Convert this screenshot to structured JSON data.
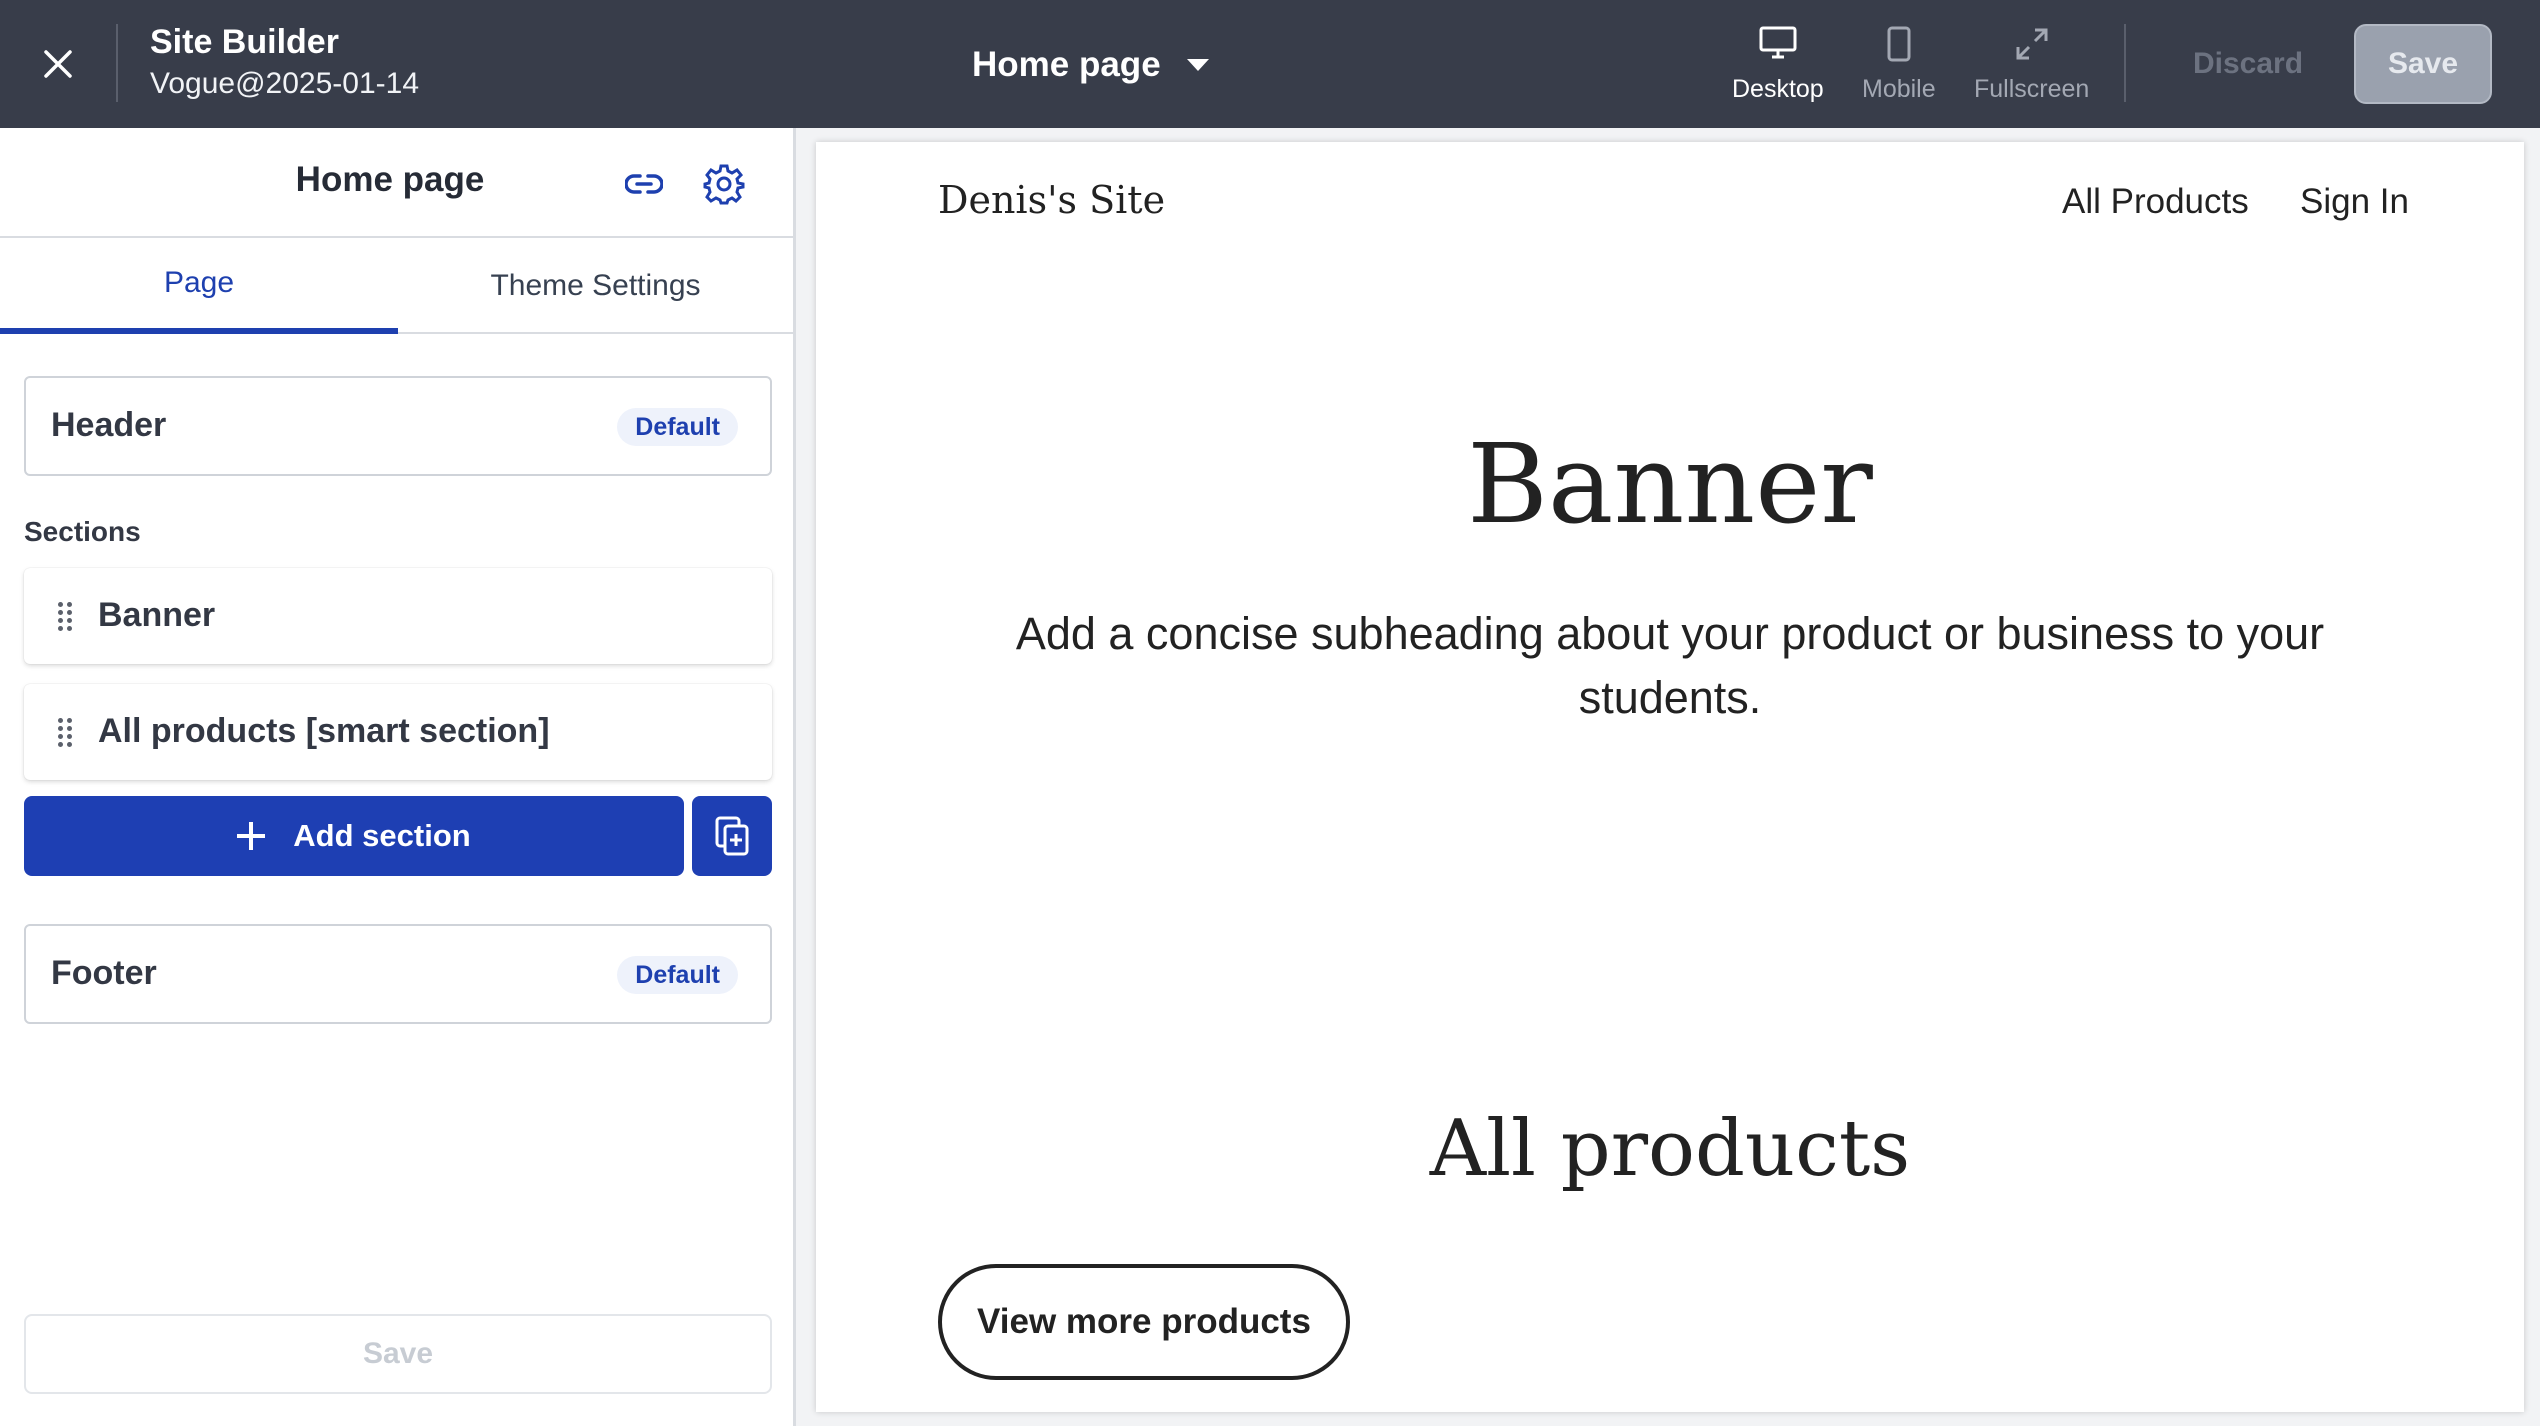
{
  "topbar": {
    "app_title": "Site Builder",
    "site_version": "Vogue@2025-01-14",
    "page_selector": "Home page",
    "views": [
      {
        "label": "Desktop",
        "icon": "monitor-icon",
        "active": true
      },
      {
        "label": "Mobile",
        "icon": "phone-icon",
        "active": false
      },
      {
        "label": "Fullscreen",
        "icon": "expand-icon",
        "active": false
      }
    ],
    "discard_label": "Discard",
    "save_label": "Save"
  },
  "sidebar": {
    "title": "Home page",
    "tabs": [
      "Page",
      "Theme Settings"
    ],
    "active_tab": "Page",
    "header_card": {
      "label": "Header",
      "badge": "Default"
    },
    "sections_heading": "Sections",
    "sections": [
      {
        "label": "Banner"
      },
      {
        "label": "All products [smart section]"
      }
    ],
    "add_section_label": "Add section",
    "footer_card": {
      "label": "Footer",
      "badge": "Default"
    },
    "save_label": "Save"
  },
  "preview": {
    "site_name": "Denis's Site",
    "nav": [
      "All Products",
      "Sign In"
    ],
    "banner_title": "Banner",
    "banner_subtitle": "Add a concise subheading about your product or business to your students.",
    "products_title": "All products",
    "more_button": "View more products"
  },
  "colors": {
    "topbar_bg": "#383d4a",
    "accent": "#1e40af",
    "primary_button": "#1e3fb3"
  }
}
